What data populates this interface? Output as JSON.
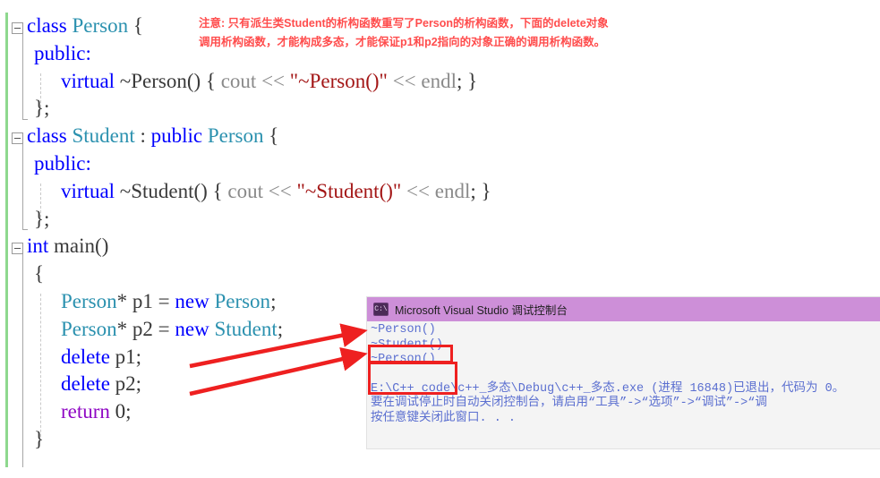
{
  "editor": {
    "name": "visual-studio-code-editor",
    "lines": [
      {
        "id": "l1",
        "indent": 0,
        "fold": true,
        "tokens": [
          {
            "t": "class",
            "c": "kw"
          },
          {
            "t": " ",
            "c": "pln"
          },
          {
            "t": "Person",
            "c": "type"
          },
          {
            "t": " {",
            "c": "pln"
          }
        ]
      },
      {
        "id": "l2",
        "indent": 1,
        "fold": false,
        "tokens": [
          {
            "t": "public:",
            "c": "kw"
          }
        ]
      },
      {
        "id": "l3",
        "indent": 2,
        "fold": false,
        "tokens": [
          {
            "t": "virtual",
            "c": "kw"
          },
          {
            "t": " ",
            "c": "pln"
          },
          {
            "t": "~Person() { ",
            "c": "pln"
          },
          {
            "t": "cout",
            "c": "dim"
          },
          {
            "t": " ",
            "c": "pln"
          },
          {
            "t": "<<",
            "c": "dim"
          },
          {
            "t": " ",
            "c": "pln"
          },
          {
            "t": "\"~Person()\"",
            "c": "str"
          },
          {
            "t": " ",
            "c": "pln"
          },
          {
            "t": "<<",
            "c": "dim"
          },
          {
            "t": " ",
            "c": "pln"
          },
          {
            "t": "endl",
            "c": "dim"
          },
          {
            "t": "; }",
            "c": "pln"
          }
        ]
      },
      {
        "id": "l4",
        "indent": 1,
        "fold": false,
        "tokens": [
          {
            "t": "};",
            "c": "pln"
          }
        ]
      },
      {
        "id": "l5",
        "indent": 0,
        "fold": true,
        "tokens": [
          {
            "t": "class",
            "c": "kw"
          },
          {
            "t": " ",
            "c": "pln"
          },
          {
            "t": "Student",
            "c": "type"
          },
          {
            "t": " : ",
            "c": "pln"
          },
          {
            "t": "public",
            "c": "kw"
          },
          {
            "t": " ",
            "c": "pln"
          },
          {
            "t": "Person",
            "c": "type"
          },
          {
            "t": " {",
            "c": "pln"
          }
        ]
      },
      {
        "id": "l6",
        "indent": 1,
        "fold": false,
        "tokens": [
          {
            "t": "public:",
            "c": "kw"
          }
        ]
      },
      {
        "id": "l7",
        "indent": 2,
        "fold": false,
        "tokens": [
          {
            "t": "virtual",
            "c": "kw"
          },
          {
            "t": " ",
            "c": "pln"
          },
          {
            "t": "~Student() { ",
            "c": "pln"
          },
          {
            "t": "cout",
            "c": "dim"
          },
          {
            "t": " ",
            "c": "pln"
          },
          {
            "t": "<<",
            "c": "dim"
          },
          {
            "t": " ",
            "c": "pln"
          },
          {
            "t": "\"~Student()\"",
            "c": "str"
          },
          {
            "t": " ",
            "c": "pln"
          },
          {
            "t": "<<",
            "c": "dim"
          },
          {
            "t": " ",
            "c": "pln"
          },
          {
            "t": "endl",
            "c": "dim"
          },
          {
            "t": "; }",
            "c": "pln"
          }
        ]
      },
      {
        "id": "l8",
        "indent": 1,
        "fold": false,
        "tokens": [
          {
            "t": "};",
            "c": "pln"
          }
        ]
      },
      {
        "id": "l9",
        "indent": 0,
        "fold": true,
        "tokens": [
          {
            "t": "int",
            "c": "kw"
          },
          {
            "t": " ",
            "c": "pln"
          },
          {
            "t": "main",
            "c": "pln"
          },
          {
            "t": "()",
            "c": "pln"
          }
        ]
      },
      {
        "id": "l10",
        "indent": 1,
        "fold": false,
        "tokens": [
          {
            "t": "{",
            "c": "pln"
          }
        ]
      },
      {
        "id": "l11",
        "indent": 2,
        "fold": false,
        "tokens": [
          {
            "t": "Person",
            "c": "type"
          },
          {
            "t": "* ",
            "c": "pln"
          },
          {
            "t": "p1",
            "c": "var"
          },
          {
            "t": " = ",
            "c": "pln"
          },
          {
            "t": "new",
            "c": "kw"
          },
          {
            "t": " ",
            "c": "pln"
          },
          {
            "t": "Person",
            "c": "type"
          },
          {
            "t": ";",
            "c": "pln"
          }
        ]
      },
      {
        "id": "l12",
        "indent": 2,
        "fold": false,
        "tokens": [
          {
            "t": "Person",
            "c": "type"
          },
          {
            "t": "* ",
            "c": "pln"
          },
          {
            "t": "p2",
            "c": "var"
          },
          {
            "t": " = ",
            "c": "pln"
          },
          {
            "t": "new",
            "c": "kw"
          },
          {
            "t": " ",
            "c": "pln"
          },
          {
            "t": "Student",
            "c": "type"
          },
          {
            "t": ";",
            "c": "pln"
          }
        ]
      },
      {
        "id": "l13",
        "indent": 2,
        "fold": false,
        "tokens": [
          {
            "t": "delete",
            "c": "kw"
          },
          {
            "t": " ",
            "c": "pln"
          },
          {
            "t": "p1",
            "c": "var"
          },
          {
            "t": ";",
            "c": "pln"
          }
        ]
      },
      {
        "id": "l14",
        "indent": 2,
        "fold": false,
        "tokens": [
          {
            "t": "delete",
            "c": "kw"
          },
          {
            "t": " ",
            "c": "pln"
          },
          {
            "t": "p2",
            "c": "var"
          },
          {
            "t": ";",
            "c": "pln"
          }
        ]
      },
      {
        "id": "l15",
        "indent": 2,
        "fold": false,
        "tokens": [
          {
            "t": "return",
            "c": "ctl"
          },
          {
            "t": " ",
            "c": "pln"
          },
          {
            "t": "0",
            "c": "num"
          },
          {
            "t": ";",
            "c": "pln"
          }
        ]
      },
      {
        "id": "l16",
        "indent": 1,
        "fold": false,
        "tokens": [
          {
            "t": "}",
            "c": "pln"
          }
        ]
      }
    ]
  },
  "annotation": {
    "line1": "注意: 只有派生类Student的析构函数重写了Person的析构函数，下面的delete对象",
    "line2": "调用析构函数，才能构成多态，才能保证p1和p2指向的对象正确的调用析构函数。",
    "color": "#ff4d4d"
  },
  "console": {
    "icon": "console-window-icon",
    "title": "Microsoft Visual Studio 调试控制台",
    "titlebar_color": "#cd8fd8",
    "text_color": "#5b6fd0",
    "output": [
      "~Person()",
      "~Student()",
      "~Person()"
    ],
    "exit_lines": [
      "E:\\C++_code\\c++_多态\\Debug\\c++_多态.exe (进程 16848)已退出，代码为 0。",
      "要在调试停止时自动关闭控制台，请启用“工具”->“选项”->“调试”->“调",
      "按任意键关闭此窗口. . ."
    ]
  },
  "callouts": {
    "box_color": "#ee2020",
    "box1_label": "person-destructor-output-highlight",
    "box2_label": "student-person-destructor-output-highlight",
    "arrow1_label": "delete-p1-to-person-output-arrow",
    "arrow2_label": "delete-p2-to-student-output-arrow"
  }
}
